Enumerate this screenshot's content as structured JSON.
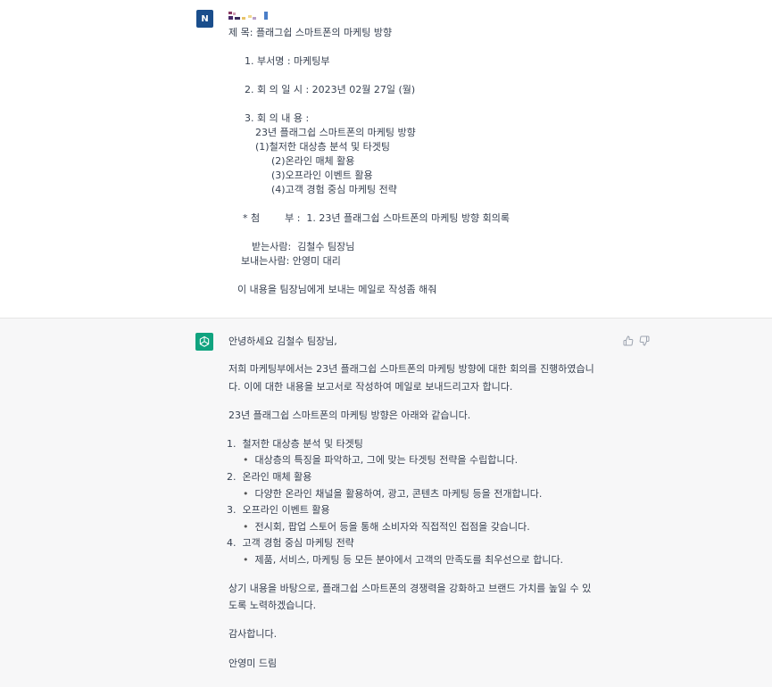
{
  "user_message": {
    "avatar_letter": "N",
    "subject": "제 목: 플래그쉽 스마트폰의 마케팅 방향",
    "item1": "1. 부서명 : 마케팅부",
    "item2": "2. 회 의 일 시 : 2023년 02월 27일 (월)",
    "item3": "3. 회 의 내 용 :",
    "item3_title": "23년 플래그쉽 스마트폰의 마케팅 방향",
    "item3_sub1": "(1)철저한 대상층 분석 및 타겟팅",
    "item3_sub2": "(2)온라인 매체 활용",
    "item3_sub3": "(3)오프라인 이벤트 활용",
    "item3_sub4": "(4)고객 경험 중심 마케팅 전략",
    "attachment": "* 첨        부 :  1. 23년 플래그쉽 스마트폰의 마케팅 방향 회의록",
    "recipient": "받는사람:  김철수 팀장님",
    "sender": "보내는사람: 안영미 대리",
    "request": "이 내용을 팀장님에게 보내는 메일로 작성좀 해줘"
  },
  "assistant_message": {
    "greeting": "안녕하세요 김철수 팀장님,",
    "para1_line1": "저희 마케팅부에서는 23년 플래그쉽 스마트폰의 마케팅 방향에 대한 회의를 진행하였습니",
    "para1_line2": "다. 이에 대한 내용을 보고서로 작성하여 메일로 보내드리고자 합니다.",
    "para2": "23년 플래그쉽 스마트폰의 마케팅 방향은 아래와 같습니다.",
    "list": [
      {
        "num": "1.",
        "title": "철저한 대상층 분석 및 타겟팅",
        "bullet": "대상층의 특징을 파악하고, 그에 맞는 타겟팅 전략을 수립합니다."
      },
      {
        "num": "2.",
        "title": "온라인 매체 활용",
        "bullet": "다양한 온라인 채널을 활용하여, 광고, 콘텐츠 마케팅 등을 전개합니다."
      },
      {
        "num": "3.",
        "title": "오프라인 이벤트 활용",
        "bullet": "전시회, 팝업 스토어 등을 통해 소비자와 직접적인 접점을 갖습니다."
      },
      {
        "num": "4.",
        "title": "고객 경험 중심 마케팅 전략",
        "bullet": "제품, 서비스, 마케팅 등 모든 분야에서 고객의 만족도를 최우선으로 합니다."
      }
    ],
    "para3_line1": "상기 내용을 바탕으로, 플래그쉽 스마트폰의 경쟁력을 강화하고 브랜드 가치를 높일 수 있",
    "para3_line2": "도록 노력하겠습니다.",
    "thanks": "감사합니다.",
    "signature": "안영미 드림",
    "bullet_char": "•"
  },
  "icons": {
    "bot": "openai-logo-icon",
    "thumbs_up": "thumbs-up-icon",
    "thumbs_down": "thumbs-down-icon"
  },
  "colors": {
    "user_avatar": "#1a4e8c",
    "bot_avatar": "#10a37f",
    "assistant_bg": "#f7f7f8"
  }
}
